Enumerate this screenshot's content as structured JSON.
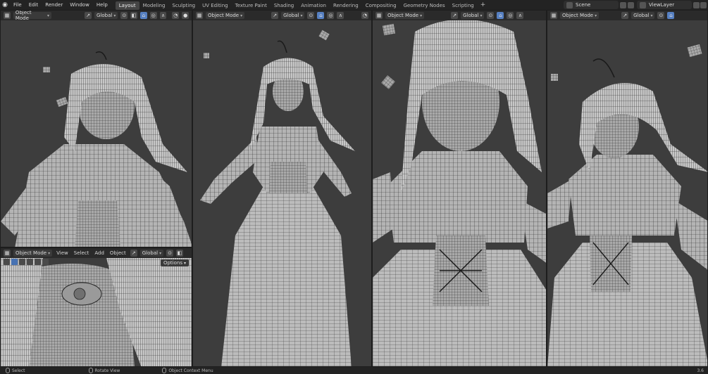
{
  "menu": [
    "File",
    "Edit",
    "Render",
    "Window",
    "Help"
  ],
  "workspaces": [
    "Layout",
    "Modeling",
    "Sculpting",
    "UV Editing",
    "Texture Paint",
    "Shading",
    "Animation",
    "Rendering",
    "Compositing",
    "Geometry Nodes",
    "Scripting"
  ],
  "active_workspace": "Layout",
  "scene": "Scene",
  "view_layer": "ViewLayer",
  "viewport_header": {
    "mode": "Object Mode",
    "orientation": "Global",
    "view_menu": "View",
    "select_menu": "Select",
    "add_menu": "Add",
    "object_menu": "Object",
    "options": "Options"
  },
  "status": {
    "select": "Select",
    "rotate": "Rotate View",
    "context": "Object Context Menu",
    "version": "3.6"
  },
  "icons": [
    "blender-logo",
    "editor-type-icon",
    "transform-orientation-icon",
    "snap-icon",
    "proportional-icon",
    "overlay-icon",
    "shading-icon"
  ]
}
